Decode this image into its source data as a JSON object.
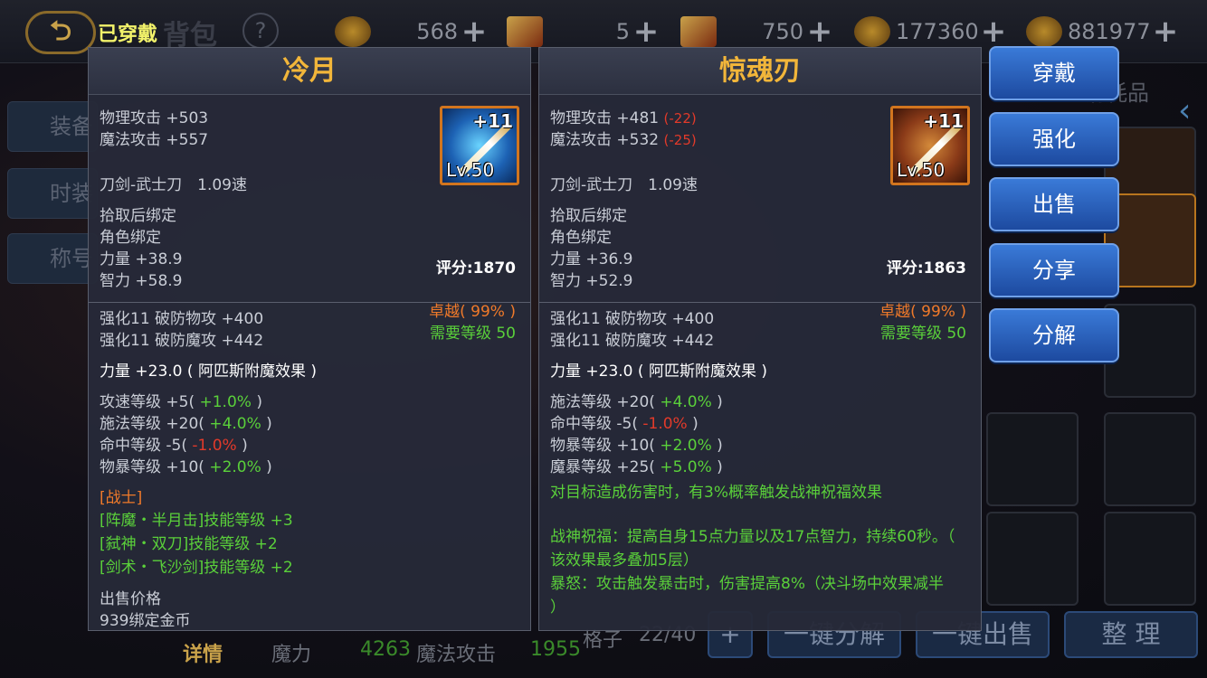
{
  "topbar": {
    "back_icon": "arrow-back-icon",
    "title": "背包",
    "help": "?",
    "resources": [
      {
        "icon": "coin-icon",
        "value": "568"
      },
      {
        "icon": "scroll-icon",
        "value": "5"
      },
      {
        "icon": "scroll-icon",
        "value": "750"
      },
      {
        "icon": "coin-icon",
        "value": "177360"
      },
      {
        "icon": "coin-icon",
        "value": "881977"
      }
    ],
    "plus": "+"
  },
  "side_tabs": [
    "装备",
    "时装",
    "称号"
  ],
  "right_tab": "消耗品",
  "worn_label": "已穿戴",
  "bottom": {
    "detail": "详情",
    "magic_label": "魔力",
    "magic_value": "4263",
    "mattack_label": "魔法攻击",
    "mattack_value": "1955",
    "bag_label": "格子",
    "bag_value": "22/40",
    "btn_decompose": "一键分解",
    "btn_sell": "一键出售",
    "btn_sort": "整 理"
  },
  "left_panel": {
    "name": "冷月",
    "icon": {
      "plus": "+11",
      "level": "Lv.50"
    },
    "base": [
      {
        "text": "物理攻击 +503"
      },
      {
        "text": "魔法攻击 +557"
      }
    ],
    "type": "刀剑-武士刀　1.09速",
    "bind1": "拾取后绑定",
    "score": "评分:1870",
    "bind2": "角色绑定",
    "str": "力量 +38.9",
    "quality": "卓越( 99% )",
    "int": "智力 +58.9",
    "req": "需要等级 50",
    "enh": [
      "强化11 破防物攻 +400",
      "强化11 破防魔攻 +442"
    ],
    "enchant": "力量 +23.0 ( 阿匹斯附魔效果 )",
    "rand": [
      {
        "a": "攻速等级 +5( ",
        "b": "+1.0%",
        "c": " )",
        "col": "grn"
      },
      {
        "a": "施法等级 +20( ",
        "b": "+4.0%",
        "c": " )",
        "col": "grn"
      },
      {
        "a": "命中等级 -5( ",
        "b": "-1.0%",
        "c": " )",
        "col": "red"
      },
      {
        "a": "物暴等级 +10( ",
        "b": "+2.0%",
        "c": " )",
        "col": "grn"
      }
    ],
    "class": "[战士]",
    "skills": [
      "[阵魔・半月击]技能等级 +3",
      "[弑神・双刀]技能等级 +2",
      "[剑术・飞沙剑]技能等级 +2"
    ],
    "sell_label": "出售价格",
    "sell_value": "939绑定金币"
  },
  "right_panel": {
    "name": "惊魂刃",
    "icon": {
      "plus": "+11",
      "level": "Lv.50"
    },
    "base": [
      {
        "text": "物理攻击 +481",
        "diff": "(-22)"
      },
      {
        "text": "魔法攻击 +532",
        "diff": "(-25)"
      }
    ],
    "type": "刀剑-武士刀　1.09速",
    "bind1": "拾取后绑定",
    "score": "评分:1863",
    "bind2": "角色绑定",
    "str": "力量 +36.9",
    "quality": "卓越( 99% )",
    "int": "智力 +52.9",
    "req": "需要等级 50",
    "enh": [
      "强化11 破防物攻 +400",
      "强化11 破防魔攻 +442"
    ],
    "enchant": "力量 +23.0 ( 阿匹斯附魔效果 )",
    "rand": [
      {
        "a": "施法等级 +20( ",
        "b": "+4.0%",
        "c": " )",
        "col": "grn"
      },
      {
        "a": "命中等级 -5( ",
        "b": "-1.0%",
        "c": " )",
        "col": "red"
      },
      {
        "a": "物暴等级 +10( ",
        "b": "+2.0%",
        "c": " )",
        "col": "grn"
      },
      {
        "a": "魔暴等级 +25( ",
        "b": "+5.0%",
        "c": " )",
        "col": "grn"
      }
    ],
    "effect": "对目标造成伤害时，有3%概率触发战神祝福效果",
    "desc": [
      "战神祝福：提高自身15点力量以及17点智力，持续60秒。（",
      "该效果最多叠加5层）",
      "暴怒：攻击触发暴击时，伤害提高8%（决斗场中效果减半",
      "）"
    ]
  },
  "actions": [
    "穿戴",
    "强化",
    "出售",
    "分享",
    "分解"
  ]
}
